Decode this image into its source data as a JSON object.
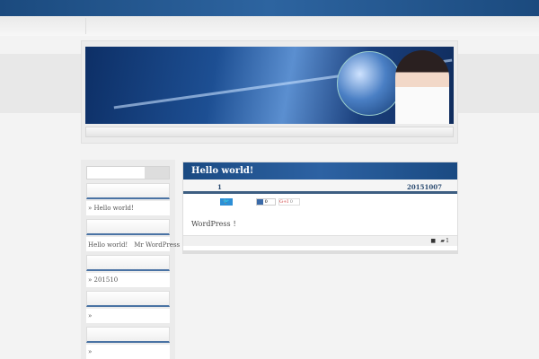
{
  "sidebar": {
    "widgets": [
      {
        "content": "» Hello world!"
      },
      {
        "content": "Hello world!　Mr WordPress"
      },
      {
        "content": "» 201510"
      },
      {
        "content": "»"
      },
      {
        "content": "»"
      }
    ]
  },
  "post": {
    "title": "Hello world!",
    "number": "1",
    "date": "20151007",
    "tweet_label": "🐦",
    "hatena_count": "0",
    "gplus_label": "G+I",
    "gplus_count": "0",
    "body": "WordPress ！",
    "comment_count": "1"
  }
}
